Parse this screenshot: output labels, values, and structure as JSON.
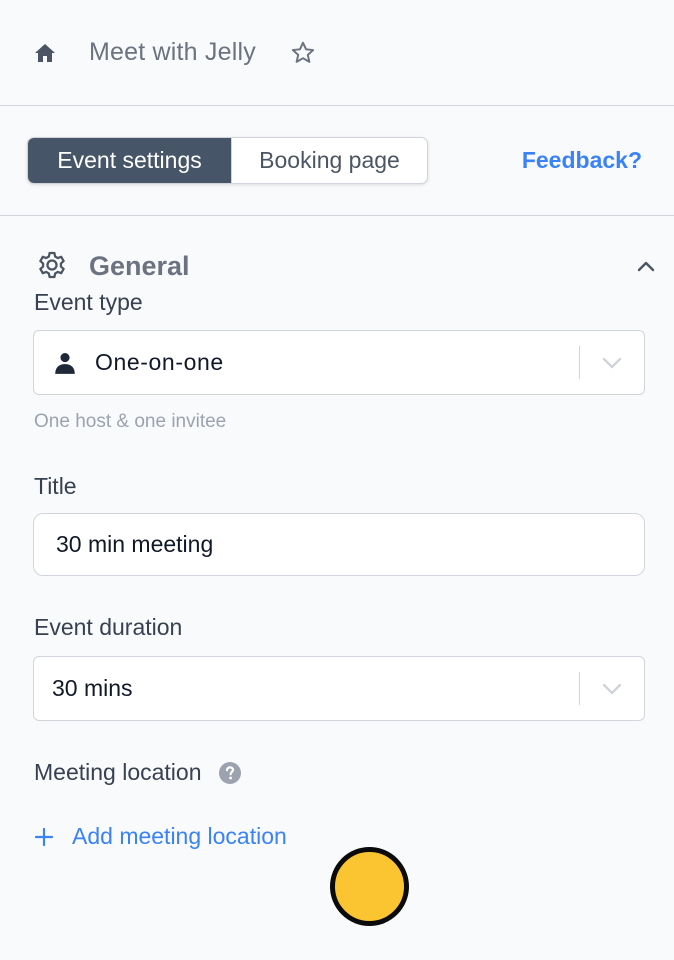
{
  "header": {
    "title": "Meet with Jelly"
  },
  "tabs": [
    {
      "label": "Event settings",
      "active": true
    },
    {
      "label": "Booking page",
      "active": false
    }
  ],
  "feedback_label": "Feedback?",
  "section": {
    "title": "General"
  },
  "event_type": {
    "label": "Event type",
    "value": "One-on-one",
    "hint": "One host & one invitee"
  },
  "title_field": {
    "label": "Title",
    "value": "30 min meeting"
  },
  "duration": {
    "label": "Event duration",
    "value": "30 mins"
  },
  "location": {
    "label": "Meeting location",
    "add_label": "Add meeting location"
  },
  "icons": {
    "home": "home-icon",
    "star": "star-icon",
    "gear": "gear-icon",
    "chevron_up": "chevron-up-icon",
    "person": "person-icon",
    "chevron_down": "chevron-down-icon",
    "help": "help-circle-icon",
    "plus": "plus-icon"
  },
  "colors": {
    "accent": "#3b82f6",
    "active_tab": "#475569",
    "cursor_marker": "#fbc531"
  }
}
